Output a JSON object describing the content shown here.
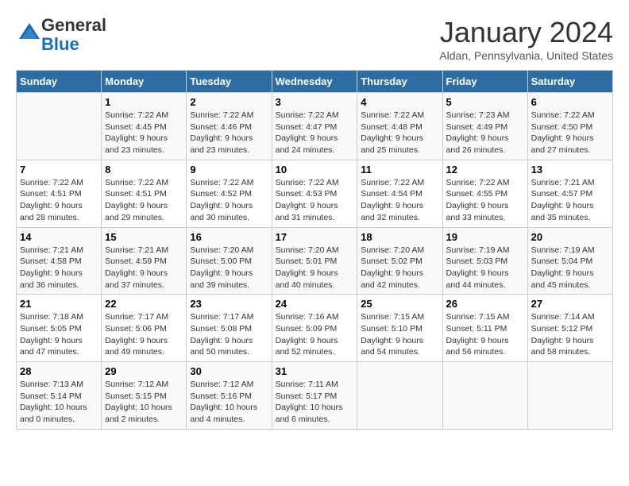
{
  "logo": {
    "general": "General",
    "blue": "Blue"
  },
  "header": {
    "month": "January 2024",
    "location": "Aldan, Pennsylvania, United States"
  },
  "weekdays": [
    "Sunday",
    "Monday",
    "Tuesday",
    "Wednesday",
    "Thursday",
    "Friday",
    "Saturday"
  ],
  "weeks": [
    [
      {
        "day": "",
        "info": ""
      },
      {
        "day": "1",
        "info": "Sunrise: 7:22 AM\nSunset: 4:45 PM\nDaylight: 9 hours\nand 23 minutes."
      },
      {
        "day": "2",
        "info": "Sunrise: 7:22 AM\nSunset: 4:46 PM\nDaylight: 9 hours\nand 23 minutes."
      },
      {
        "day": "3",
        "info": "Sunrise: 7:22 AM\nSunset: 4:47 PM\nDaylight: 9 hours\nand 24 minutes."
      },
      {
        "day": "4",
        "info": "Sunrise: 7:22 AM\nSunset: 4:48 PM\nDaylight: 9 hours\nand 25 minutes."
      },
      {
        "day": "5",
        "info": "Sunrise: 7:23 AM\nSunset: 4:49 PM\nDaylight: 9 hours\nand 26 minutes."
      },
      {
        "day": "6",
        "info": "Sunrise: 7:22 AM\nSunset: 4:50 PM\nDaylight: 9 hours\nand 27 minutes."
      }
    ],
    [
      {
        "day": "7",
        "info": "Sunrise: 7:22 AM\nSunset: 4:51 PM\nDaylight: 9 hours\nand 28 minutes."
      },
      {
        "day": "8",
        "info": "Sunrise: 7:22 AM\nSunset: 4:51 PM\nDaylight: 9 hours\nand 29 minutes."
      },
      {
        "day": "9",
        "info": "Sunrise: 7:22 AM\nSunset: 4:52 PM\nDaylight: 9 hours\nand 30 minutes."
      },
      {
        "day": "10",
        "info": "Sunrise: 7:22 AM\nSunset: 4:53 PM\nDaylight: 9 hours\nand 31 minutes."
      },
      {
        "day": "11",
        "info": "Sunrise: 7:22 AM\nSunset: 4:54 PM\nDaylight: 9 hours\nand 32 minutes."
      },
      {
        "day": "12",
        "info": "Sunrise: 7:22 AM\nSunset: 4:55 PM\nDaylight: 9 hours\nand 33 minutes."
      },
      {
        "day": "13",
        "info": "Sunrise: 7:21 AM\nSunset: 4:57 PM\nDaylight: 9 hours\nand 35 minutes."
      }
    ],
    [
      {
        "day": "14",
        "info": "Sunrise: 7:21 AM\nSunset: 4:58 PM\nDaylight: 9 hours\nand 36 minutes."
      },
      {
        "day": "15",
        "info": "Sunrise: 7:21 AM\nSunset: 4:59 PM\nDaylight: 9 hours\nand 37 minutes."
      },
      {
        "day": "16",
        "info": "Sunrise: 7:20 AM\nSunset: 5:00 PM\nDaylight: 9 hours\nand 39 minutes."
      },
      {
        "day": "17",
        "info": "Sunrise: 7:20 AM\nSunset: 5:01 PM\nDaylight: 9 hours\nand 40 minutes."
      },
      {
        "day": "18",
        "info": "Sunrise: 7:20 AM\nSunset: 5:02 PM\nDaylight: 9 hours\nand 42 minutes."
      },
      {
        "day": "19",
        "info": "Sunrise: 7:19 AM\nSunset: 5:03 PM\nDaylight: 9 hours\nand 44 minutes."
      },
      {
        "day": "20",
        "info": "Sunrise: 7:19 AM\nSunset: 5:04 PM\nDaylight: 9 hours\nand 45 minutes."
      }
    ],
    [
      {
        "day": "21",
        "info": "Sunrise: 7:18 AM\nSunset: 5:05 PM\nDaylight: 9 hours\nand 47 minutes."
      },
      {
        "day": "22",
        "info": "Sunrise: 7:17 AM\nSunset: 5:06 PM\nDaylight: 9 hours\nand 49 minutes."
      },
      {
        "day": "23",
        "info": "Sunrise: 7:17 AM\nSunset: 5:08 PM\nDaylight: 9 hours\nand 50 minutes."
      },
      {
        "day": "24",
        "info": "Sunrise: 7:16 AM\nSunset: 5:09 PM\nDaylight: 9 hours\nand 52 minutes."
      },
      {
        "day": "25",
        "info": "Sunrise: 7:15 AM\nSunset: 5:10 PM\nDaylight: 9 hours\nand 54 minutes."
      },
      {
        "day": "26",
        "info": "Sunrise: 7:15 AM\nSunset: 5:11 PM\nDaylight: 9 hours\nand 56 minutes."
      },
      {
        "day": "27",
        "info": "Sunrise: 7:14 AM\nSunset: 5:12 PM\nDaylight: 9 hours\nand 58 minutes."
      }
    ],
    [
      {
        "day": "28",
        "info": "Sunrise: 7:13 AM\nSunset: 5:14 PM\nDaylight: 10 hours\nand 0 minutes."
      },
      {
        "day": "29",
        "info": "Sunrise: 7:12 AM\nSunset: 5:15 PM\nDaylight: 10 hours\nand 2 minutes."
      },
      {
        "day": "30",
        "info": "Sunrise: 7:12 AM\nSunset: 5:16 PM\nDaylight: 10 hours\nand 4 minutes."
      },
      {
        "day": "31",
        "info": "Sunrise: 7:11 AM\nSunset: 5:17 PM\nDaylight: 10 hours\nand 6 minutes."
      },
      {
        "day": "",
        "info": ""
      },
      {
        "day": "",
        "info": ""
      },
      {
        "day": "",
        "info": ""
      }
    ]
  ]
}
